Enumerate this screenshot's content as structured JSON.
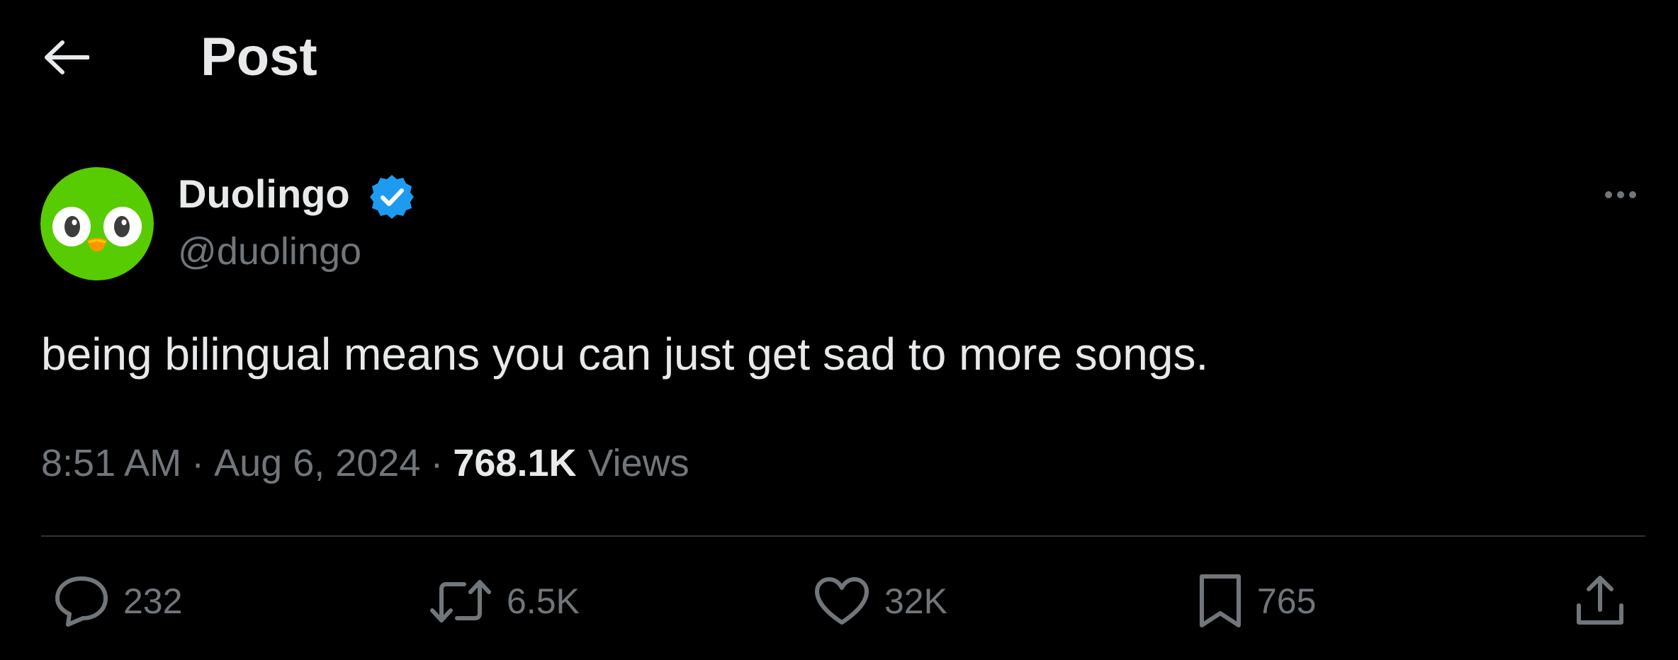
{
  "header": {
    "title": "Post",
    "back_icon": "arrow-left-icon"
  },
  "author": {
    "name": "Duolingo",
    "handle": "@duolingo",
    "verified_icon": "verified-badge-icon",
    "avatar_icon": "duolingo-owl-icon",
    "avatar_color": "#58cc02"
  },
  "post": {
    "text": "being bilingual means you can just get sad to more songs.",
    "time": "8:51 AM",
    "separator": "·",
    "date": "Aug 6, 2024",
    "views_count": "768.1K",
    "views_label": "Views"
  },
  "actions": {
    "reply_count": "232",
    "repost_count": "6.5K",
    "like_count": "32K",
    "bookmark_count": "765"
  },
  "colors": {
    "background": "#000000",
    "primary_text": "#e7e9ea",
    "secondary_text": "#71767b",
    "verified_blue": "#1d9bf0",
    "divider": "#2f3336"
  }
}
